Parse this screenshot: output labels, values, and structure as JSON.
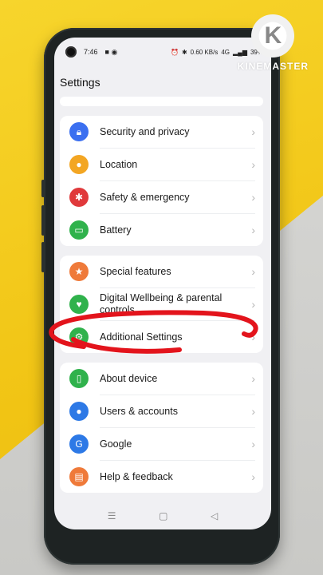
{
  "status_bar": {
    "time": "7:46",
    "speed": "0.60 KB/s",
    "network": "4G",
    "battery": "39%"
  },
  "header": {
    "title": "Settings"
  },
  "groups": [
    {
      "items": [
        {
          "label": "Security and privacy",
          "icon": "lock-icon",
          "color": "#3b6ff0"
        },
        {
          "label": "Location",
          "icon": "location-pin-icon",
          "color": "#f3a623"
        },
        {
          "label": "Safety & emergency",
          "icon": "asterisk-icon",
          "color": "#e0393b"
        },
        {
          "label": "Battery",
          "icon": "battery-icon",
          "color": "#30b24c"
        }
      ]
    },
    {
      "items": [
        {
          "label": "Special features",
          "icon": "star-icon",
          "color": "#ef7a3a"
        },
        {
          "label": "Digital Wellbeing & parental controls",
          "icon": "wellbeing-icon",
          "color": "#30b24c"
        },
        {
          "label": "Additional Settings",
          "icon": "gear-icon",
          "color": "#30b24c"
        }
      ]
    },
    {
      "items": [
        {
          "label": "About device",
          "icon": "phone-icon",
          "color": "#30b24c"
        },
        {
          "label": "Users & accounts",
          "icon": "user-icon",
          "color": "#2d79e6"
        },
        {
          "label": "Google",
          "icon": "google-icon",
          "color": "#2d79e6"
        },
        {
          "label": "Help & feedback",
          "icon": "help-card-icon",
          "color": "#ef7a3a"
        }
      ]
    }
  ],
  "watermark": {
    "text": "KINEMASTER",
    "logo_letter": "K"
  },
  "annotation_color": "#e3141c"
}
